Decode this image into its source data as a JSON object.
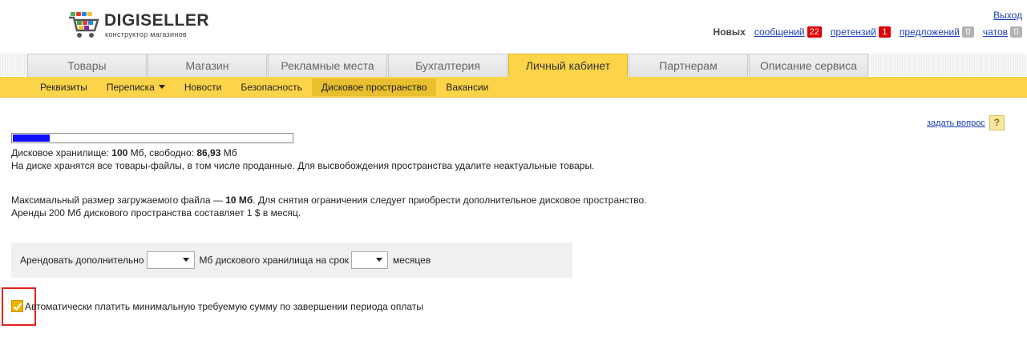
{
  "brand": {
    "title": "DIGISELLER",
    "subtitle": "конструктор магазинов"
  },
  "header": {
    "logout_label": "Выход",
    "new_label": "Новых",
    "counters": [
      {
        "label": "сообщений",
        "count": "22",
        "color": "#e00000"
      },
      {
        "label": "претензий",
        "count": "1",
        "color": "#e00000"
      },
      {
        "label": "предложений",
        "count": "0",
        "color": "#b3b3b3"
      },
      {
        "label": "чатов",
        "count": "0",
        "color": "#b3b3b3"
      }
    ]
  },
  "tabs": [
    {
      "label": "Товары",
      "active": false
    },
    {
      "label": "Магазин",
      "active": false
    },
    {
      "label": "Рекламные места",
      "active": false
    },
    {
      "label": "Бухгалтерия",
      "active": false
    },
    {
      "label": "Личный кабинет",
      "active": true
    },
    {
      "label": "Партнерам",
      "active": false
    },
    {
      "label": "Описание сервиса",
      "active": false
    }
  ],
  "subnav": [
    {
      "label": "Реквизиты",
      "active": false
    },
    {
      "label": "Переписка",
      "active": false,
      "dropdown": true
    },
    {
      "label": "Новости",
      "active": false
    },
    {
      "label": "Безопасность",
      "active": false
    },
    {
      "label": "Дисковое пространство",
      "active": true
    },
    {
      "label": "Вакансии",
      "active": false
    }
  ],
  "help": {
    "ask_label": "задать вопрос",
    "icon": "question-icon"
  },
  "storage": {
    "used_fraction": 0.131,
    "total_prefix": "Дисковое хранилище: ",
    "total_value": "100",
    "total_unit": " Мб, свободно: ",
    "free_value": "86,93",
    "free_unit": " Мб",
    "note": "На диске хранятся все товары-файлы, в том числе проданные. Для высвобождения пространства удалите неактуальные товары."
  },
  "limits": {
    "max_prefix": "Максимальный размер загружаемого файла — ",
    "max_value": "10 Мб",
    "max_suffix": ". Для снятия ограничения следует приобрести дополнительное дисковое пространство.",
    "rent_note": "Аренды 200 Мб дискового пространства составляет 1 $ в месяц."
  },
  "rent_form": {
    "label_before": "Арендовать дополнительно",
    "label_middle": "Мб дискового хранилища на срок",
    "label_after": "месяцев",
    "amount_value": "",
    "months_value": ""
  },
  "autopay": {
    "checked": true,
    "label": "Автоматически платить минимальную требуемую сумму по завершении периода оплаты"
  },
  "colors": {
    "accent": "#fcd44a",
    "link": "#1a3fb5",
    "progress": "#1010ff"
  }
}
